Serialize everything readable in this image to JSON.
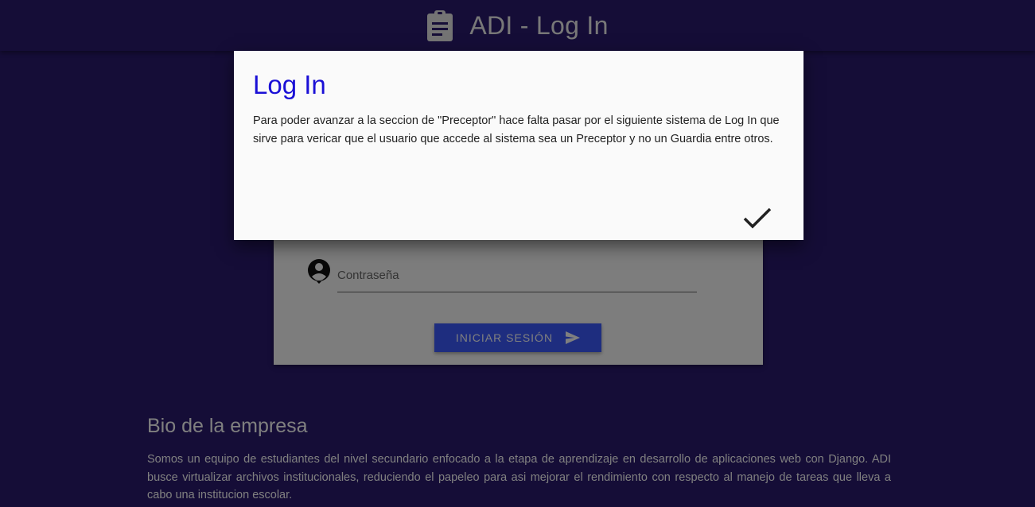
{
  "header": {
    "title": "ADI - Log In",
    "icon": "clipboard-icon"
  },
  "login_form": {
    "password_placeholder": "Contraseña",
    "user_icon": "account-circle-icon",
    "submit_label": "INICIAR SESIÓN",
    "submit_icon": "send-icon",
    "submit_color": "#3d5afe"
  },
  "bio": {
    "title": "Bio de la empresa",
    "text": "Somos un equipo de estudiantes del nivel secundario enfocado a la etapa de aprendizaje en desarrollo de aplicaciones web con Django. ADI busce virtualizar archivos institucionales, reduciendo el papeleo para asi mejorar el rendimiento con respecto al manejo de tareas que lleva a cabo una institucion escolar."
  },
  "modal": {
    "title": "Log In",
    "body": "Para poder avanzar a la seccion de \"Preceptor\" hace falta pasar por el siguiente sistema de Log In que sirve para vericar que el usuario que accede al sistema sea un Preceptor y no un Guardia entre otros.",
    "confirm_icon": "check-icon",
    "title_color": "#1a0fd6"
  },
  "colors": {
    "background": "#2a1a6e",
    "card": "#fafafa"
  }
}
